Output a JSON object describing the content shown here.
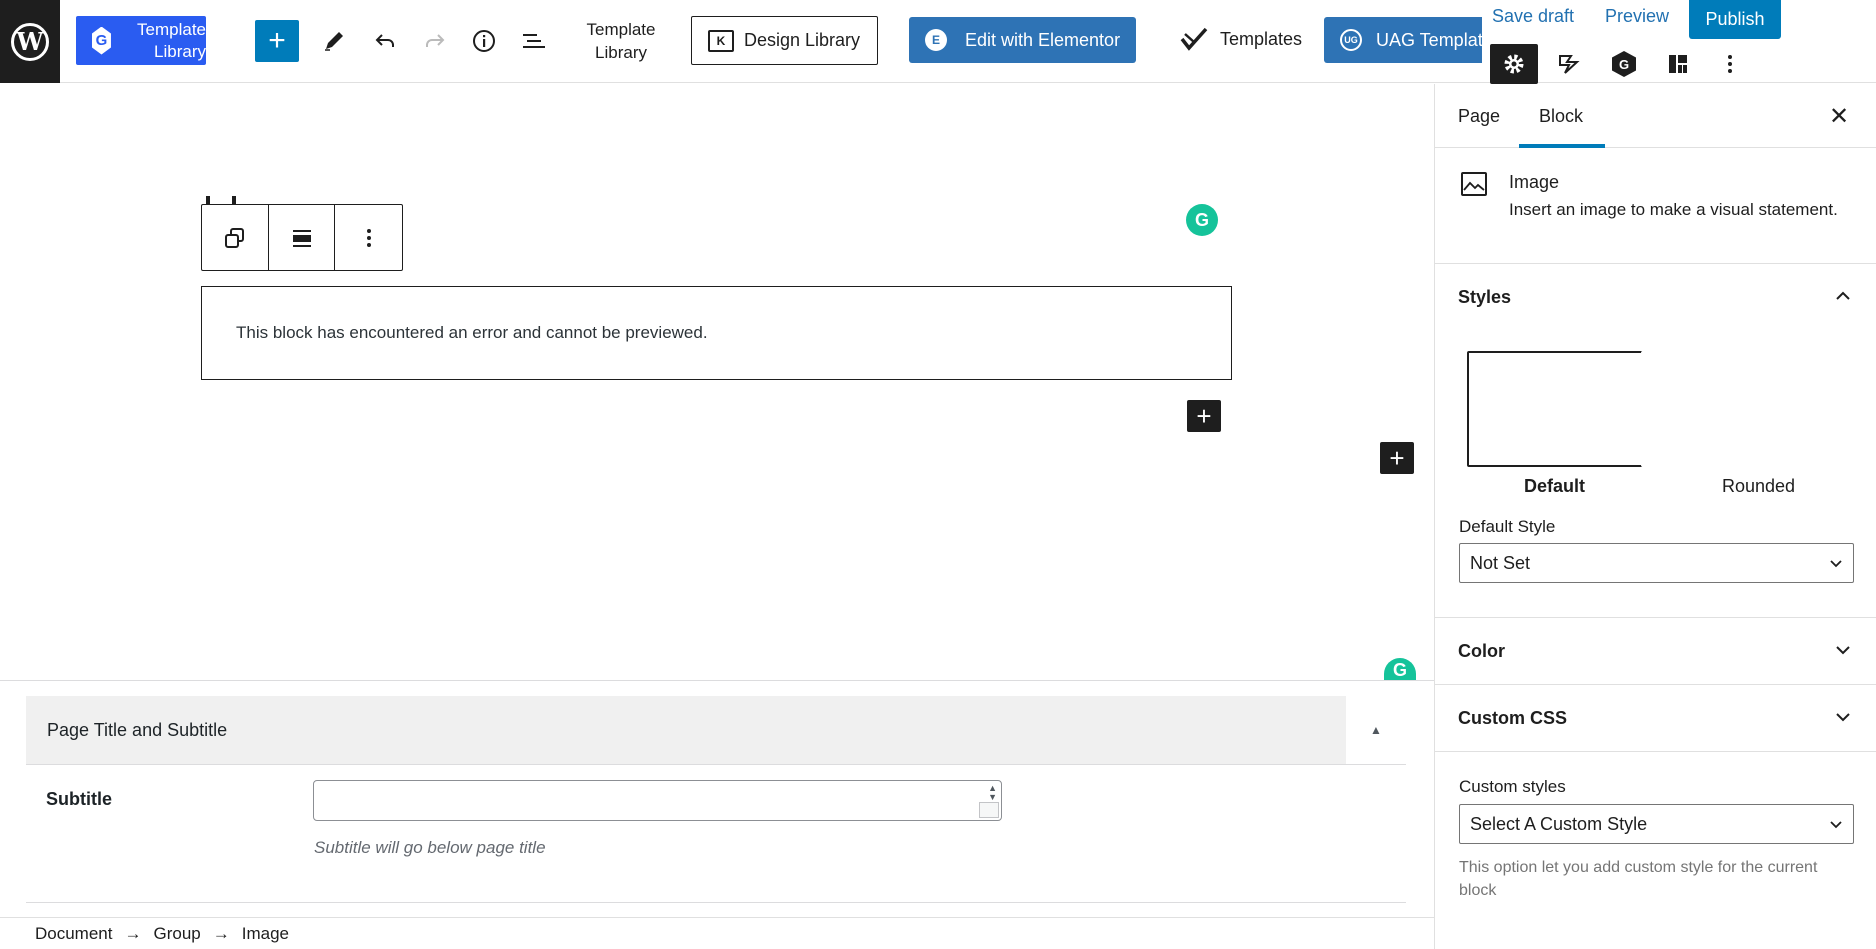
{
  "header": {
    "wp_logo": "W",
    "template_library_btn": "Template Library",
    "template_library_text": "Template Library",
    "design_library": "Design Library",
    "edit_with_elementor": "Edit with Elementor",
    "templates": "Templates",
    "uag_templates": "UAG Templates",
    "save_draft": "Save draft",
    "preview": "Preview",
    "publish": "Publish"
  },
  "canvas": {
    "error_message": "This block has encountered an error and cannot be previewed."
  },
  "metabox": {
    "title": "Page Title and Subtitle",
    "subtitle_label": "Subtitle",
    "subtitle_value": "",
    "subtitle_hint": "Subtitle will go below page title"
  },
  "breadcrumb": [
    "Document",
    "Group",
    "Image"
  ],
  "sidebar": {
    "tabs": [
      "Page",
      "Block"
    ],
    "active_tab": "Block",
    "block": {
      "name": "Image",
      "description": "Insert an image to make a visual statement."
    },
    "styles": {
      "heading": "Styles",
      "options": [
        "Default",
        "Rounded"
      ],
      "selected": "Default",
      "default_style_label": "Default Style",
      "default_style_value": "Not Set"
    },
    "color": {
      "heading": "Color"
    },
    "custom_css": {
      "heading": "Custom CSS"
    },
    "custom_styles": {
      "label": "Custom styles",
      "value": "Select A Custom Style",
      "help": "This option let you add custom style for the current block"
    }
  },
  "colors": {
    "accent": "#007cba",
    "template_library_blue": "#2a5cf1",
    "elementor_blue": "#2e73b5",
    "grammarly_green": "#15c39a",
    "dark": "#1e1e1e"
  }
}
